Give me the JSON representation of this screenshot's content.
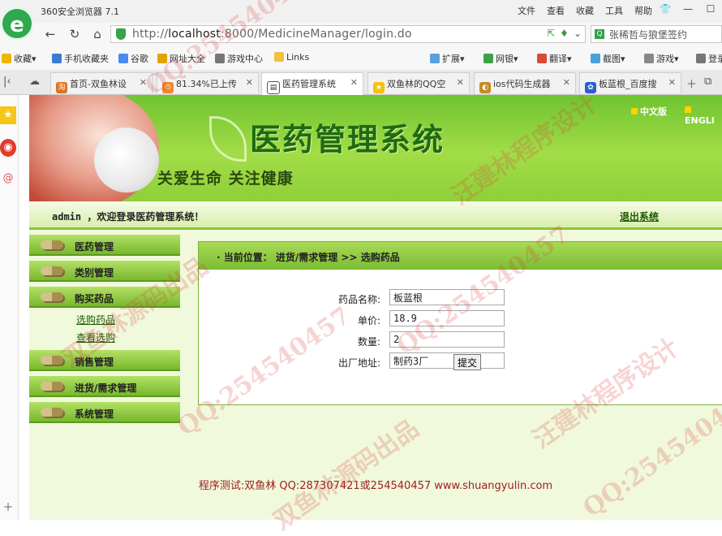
{
  "browser": {
    "app_title": "360安全浏览器 7.1",
    "menu": [
      "文件",
      "查看",
      "收藏",
      "工具",
      "帮助"
    ],
    "url_prefix": "http://",
    "url_host": "localhost",
    "url_rest": ":8000/MedicineManager/login.do",
    "search_text": "张稀哲与狼堡签约",
    "bookmarks": [
      "收藏",
      "手机收藏夹",
      "谷歌",
      "网址大全",
      "游戏中心",
      "Links",
      "扩展",
      "网银",
      "翻译",
      "截图",
      "游戏",
      "登录"
    ],
    "tabs": [
      "首页-双鱼林设",
      "81.34%已上传",
      "医药管理系统",
      "双鱼林的QQ空",
      "ios代码生成器",
      "板蓝根_百度搜"
    ]
  },
  "banner": {
    "title": "医药管理系统",
    "slogan": "关爱生命  关注健康",
    "lang_cn": "中文版",
    "lang_en": "ENGLI"
  },
  "welcome": {
    "text": "admin ，欢迎登录医药管理系统！",
    "logout": "退出系统"
  },
  "nav": {
    "items": [
      "医药管理",
      "类别管理",
      "购买药品",
      "销售管理",
      "进货/需求管理",
      "系统管理"
    ],
    "sub_items": [
      "选购药品",
      "查看选购"
    ]
  },
  "breadcrumb": "· 当前位置：  进货/需求管理  >>  选购药品",
  "form": {
    "name_label": "药品名称:",
    "name_value": "板蓝根",
    "price_label": "单价:",
    "price_value": "18.9",
    "qty_label": "数量:",
    "qty_value": "2",
    "addr_label": "出厂地址:",
    "addr_value": "制药3厂",
    "submit_label": "提交"
  },
  "footer": "程序测试:双鱼林 QQ:287307421或254540457 www.shuangyulin.com",
  "watermarks": [
    "QQ:254540457",
    "双鱼林源码出品",
    "汪建林程序设计",
    "QQ:254540457",
    "双鱼林源码出品",
    "汪建林程序设计",
    "QQ:254540457",
    "QQ:254540457"
  ]
}
